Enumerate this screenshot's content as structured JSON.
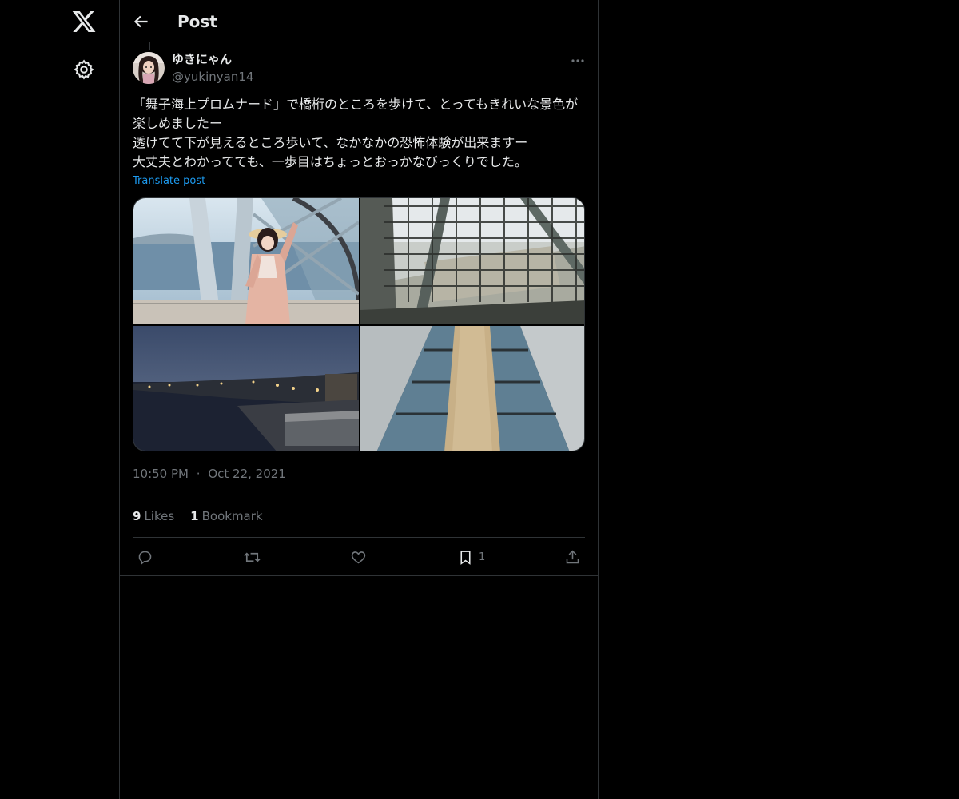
{
  "header": {
    "title": "Post"
  },
  "author": {
    "display_name": "ゆきにゃん",
    "handle": "@yukinyan14"
  },
  "post": {
    "text": "「舞子海上プロムナード」で橋桁のところを歩けて、とってもきれいな景色が楽しめましたー\n透けてて下が見えるところ歩いて、なかなかの恐怖体験が出来ますー\n大丈夫とわかってても、一歩目はちょっとおっかなびっくりでした。",
    "translate_label": "Translate post",
    "time": "10:50 PM",
    "separator": "·",
    "date": "Oct 22, 2021"
  },
  "stats": {
    "likes_count": "9",
    "likes_label": "Likes",
    "bookmarks_count": "1",
    "bookmarks_label": "Bookmark"
  },
  "actions": {
    "bookmark_count": "1"
  },
  "icons": {
    "logo": "x-logo-icon",
    "settings": "gear-icon",
    "back": "arrow-left-icon",
    "more": "more-horizontal-icon",
    "reply": "reply-icon",
    "repost": "repost-icon",
    "like": "heart-icon",
    "bookmark": "bookmark-icon",
    "share": "share-icon"
  },
  "colors": {
    "background": "#000000",
    "text": "#e7e9ea",
    "secondary": "#71767b",
    "link": "#1d9bf0",
    "border": "#2f3336"
  }
}
